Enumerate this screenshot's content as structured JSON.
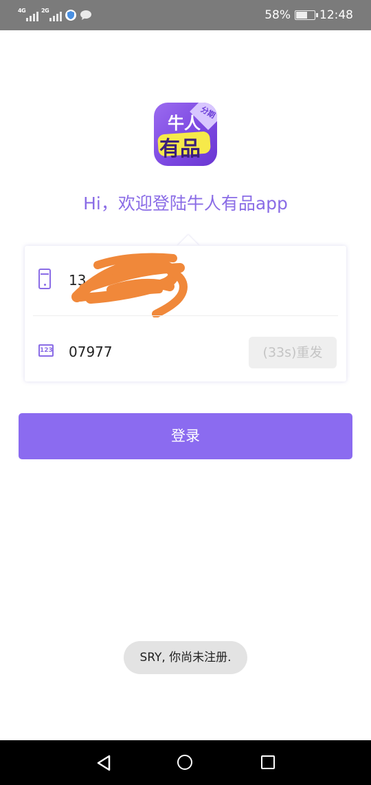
{
  "status_bar": {
    "network_1": "4G",
    "network_2": "2G",
    "battery": "58%",
    "battery_level": 0.58,
    "time": "12:48"
  },
  "logo": {
    "line1": "牛人",
    "line2": "有品",
    "tag": "分期"
  },
  "welcome_text": "Hi，欢迎登陆牛人有品app",
  "form": {
    "phone_value": "13",
    "code_value": "07977",
    "resend_label": "(33s)重发",
    "code_icon_text": "123"
  },
  "login_button": "登录",
  "toast": "SRY, 你尚未注册.",
  "colors": {
    "accent": "#8b6bf0",
    "status_bar": "#7b7b7b",
    "redaction": "#f0883a"
  }
}
